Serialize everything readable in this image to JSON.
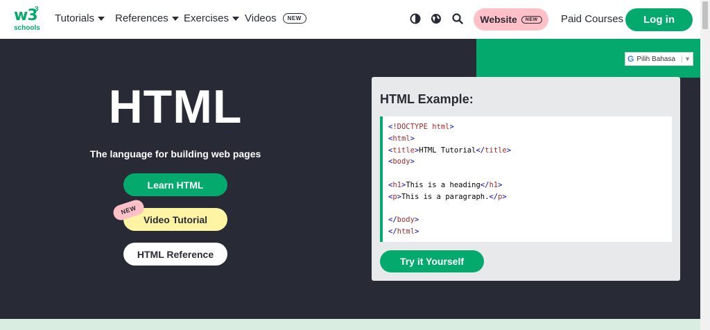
{
  "nav": {
    "logo_text": "w3",
    "logo_sup": "3",
    "logo_sub": "schools",
    "items": [
      {
        "label": "Tutorials"
      },
      {
        "label": "References"
      },
      {
        "label": "Exercises"
      },
      {
        "label": "Videos",
        "badge": "NEW"
      }
    ],
    "icons": [
      "contrast-icon",
      "globe-icon",
      "search-icon"
    ],
    "website_label": "Website",
    "website_badge": "NEW",
    "paid_courses": "Paid Courses",
    "login": "Log in"
  },
  "translate": {
    "g": "G",
    "label": "Pilih Bahasa",
    "arrow": "▼"
  },
  "hero": {
    "title": "HTML",
    "subtitle": "The language for building web pages",
    "learn": "Learn HTML",
    "video": "Video Tutorial",
    "video_badge": "NEW",
    "reference": "HTML Reference"
  },
  "example": {
    "title": "HTML Example:",
    "try_button": "Try it Yourself",
    "code_lines": [
      "<!DOCTYPE html>",
      "<html>",
      "<title>HTML Tutorial</title>",
      "<body>",
      "",
      "<h1>This is a heading</h1>",
      "<p>This is a paragraph.</p>",
      "",
      "</body>",
      "</html>"
    ]
  },
  "colors": {
    "green": "#04AA6D",
    "dark": "#282A35",
    "pink": "#FFC0C7",
    "yellow": "#FFF4A3"
  }
}
